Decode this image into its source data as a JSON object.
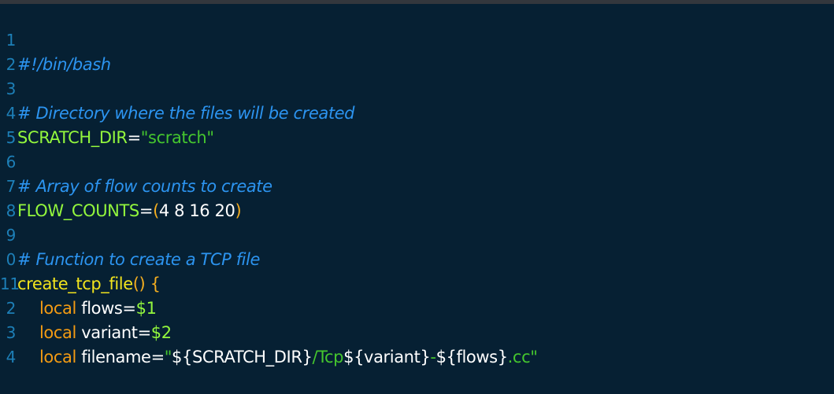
{
  "line_numbers": [
    "1",
    "2",
    "3",
    "4",
    "5",
    "6",
    "7",
    "8",
    "9",
    "0",
    "11",
    "2",
    "3",
    "4"
  ],
  "lines": {
    "l1": {
      "comment": "#!/bin/bash"
    },
    "l3": {
      "comment": "# Directory where the files will be created"
    },
    "l4": {
      "var": "SCRATCH_DIR",
      "eq": "=",
      "str": "\"scratch\""
    },
    "l6": {
      "comment": "# Array of flow counts to create"
    },
    "l7": {
      "var": "FLOW_COUNTS",
      "eq": "=",
      "open": "(",
      "values": "4 8 16 20",
      "close": ")"
    },
    "l9": {
      "comment": "# Function to create a TCP file"
    },
    "l10": {
      "fn": "create_tcp_file",
      "parens": "()",
      "brace": " {"
    },
    "l11": {
      "kw": "local",
      "var": " flows",
      "eq": "=",
      "arg": "$1"
    },
    "l12": {
      "kw": "local",
      "var": " variant",
      "eq": "=",
      "arg": "$2"
    },
    "l13": {
      "kw": "local",
      "var": " filename",
      "eq": "=",
      "q1": "\"",
      "sub1": "${SCRATCH_DIR}",
      "s1": "/Tcp",
      "sub2": "${variant}",
      "s2": "-",
      "sub3": "${flows}",
      "s3": ".cc",
      "q2": "\""
    }
  },
  "colors": {
    "background": "#062033",
    "comment": "#2c94f0",
    "variable": "#93f73d",
    "string": "#45c62e",
    "paren": "#f3ad20",
    "function": "#f2e41d",
    "keyword": "#f39b13",
    "line_number": "#1d7fb7"
  }
}
